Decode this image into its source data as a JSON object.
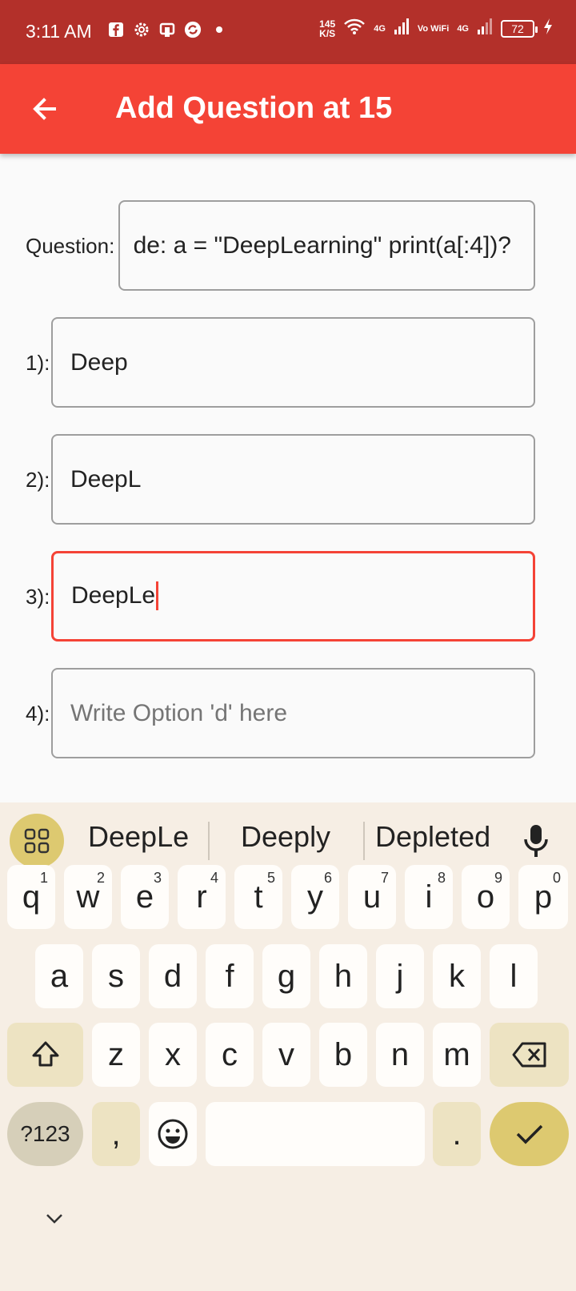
{
  "status_bar": {
    "time": "3:11 AM",
    "speed_value": "145",
    "speed_unit": "K/S",
    "net1": "4G",
    "volte": "Vo WiFi",
    "net2": "4G",
    "battery": "72",
    "colors": {
      "background": "#b3302a"
    }
  },
  "app_bar": {
    "title": "Add Question at 15",
    "colors": {
      "background": "#f44336",
      "text": "#ffffff"
    }
  },
  "form": {
    "question_label": "Question:",
    "question_value": "de: a = \"DeepLearning\" print(a[:4])?",
    "options": [
      {
        "label": "1):",
        "value": "Deep",
        "placeholder": ""
      },
      {
        "label": "2):",
        "value": "DeepL",
        "placeholder": ""
      },
      {
        "label": "3):",
        "value": "DeepLe",
        "placeholder": ""
      },
      {
        "label": "4):",
        "value": "",
        "placeholder": "Write Option 'd' here"
      }
    ],
    "focus_color": "#f44336"
  },
  "keyboard": {
    "suggestions": [
      "DeepLe",
      "Deeply",
      "Depleted"
    ],
    "row1": [
      {
        "key": "q",
        "hint": "1"
      },
      {
        "key": "w",
        "hint": "2"
      },
      {
        "key": "e",
        "hint": "3"
      },
      {
        "key": "r",
        "hint": "4"
      },
      {
        "key": "t",
        "hint": "5"
      },
      {
        "key": "y",
        "hint": "6"
      },
      {
        "key": "u",
        "hint": "7"
      },
      {
        "key": "i",
        "hint": "8"
      },
      {
        "key": "o",
        "hint": "9"
      },
      {
        "key": "p",
        "hint": "0"
      }
    ],
    "row2": [
      "a",
      "s",
      "d",
      "f",
      "g",
      "h",
      "j",
      "k",
      "l"
    ],
    "row3": [
      "z",
      "x",
      "c",
      "v",
      "b",
      "n",
      "m"
    ],
    "symbols_label": "?123",
    "comma": ",",
    "period": ".",
    "colors": {
      "background": "#f6eee4",
      "accent": "#ddc970",
      "function_key": "#ede3c2"
    }
  }
}
